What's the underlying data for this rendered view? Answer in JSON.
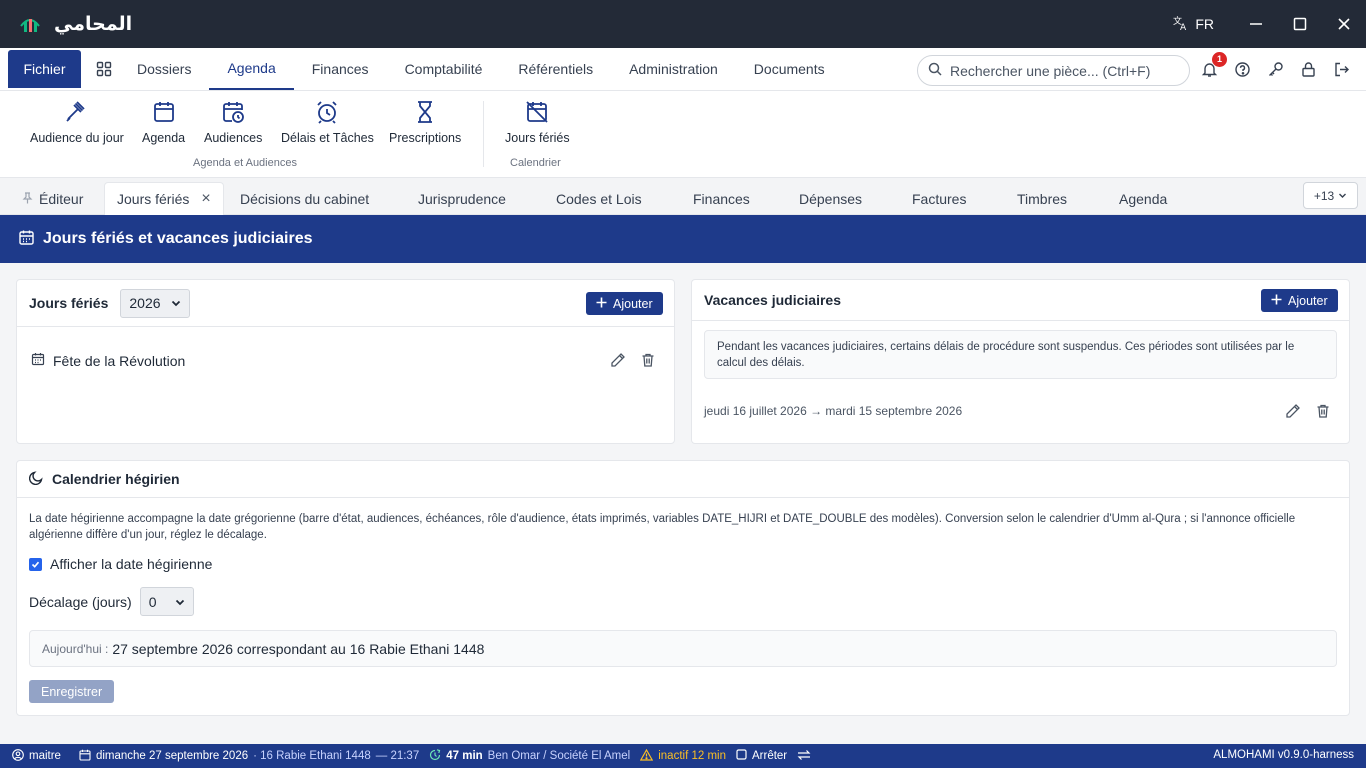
{
  "app": {
    "name": "المحامي",
    "language": "FR"
  },
  "menu": {
    "fichier": "Fichier",
    "items": [
      "Dossiers",
      "Agenda",
      "Finances",
      "Comptabilité",
      "Référentiels",
      "Administration",
      "Documents"
    ],
    "active": "Agenda",
    "search_placeholder": "Rechercher une pièce... (Ctrl+F)",
    "notification_count": "1"
  },
  "ribbon": {
    "buttons": [
      "Audience du jour",
      "Agenda",
      "Audiences",
      "Délais et Tâches",
      "Prescriptions",
      "Jours fériés"
    ],
    "groups": [
      "Agenda et Audiences",
      "Calendrier"
    ]
  },
  "tabs": {
    "items": [
      "Éditeur",
      "Jours fériés",
      "Décisions du cabinet",
      "Jurisprudence",
      "Codes et Lois",
      "Finances",
      "Dépenses",
      "Factures",
      "Timbres",
      "Agenda"
    ],
    "active": "Jours fériés",
    "more": "+13"
  },
  "page": {
    "title": "Jours fériés et vacances judiciaires"
  },
  "holidays": {
    "title": "Jours fériés",
    "year": "2026",
    "add_label": "Ajouter",
    "items": [
      "Fête de la Révolution"
    ]
  },
  "vacations": {
    "title": "Vacances judiciaires",
    "add_label": "Ajouter",
    "info": "Pendant les vacances judiciaires, certains délais de procédure sont suspendus. Ces périodes sont utilisées par le calcul des délais.",
    "period": "jeudi 16 juillet 2026 → mardi 15 septembre 2026"
  },
  "hijri": {
    "title": "Calendrier hégirien",
    "description": "La date hégirienne accompagne la date grégorienne (barre d'état, audiences, échéances, rôle d'audience, états imprimés, variables DATE_HIJRI et DATE_DOUBLE des modèles). Conversion selon le calendrier d'Umm al-Qura ; si l'annonce officielle algérienne diffère d'un jour, réglez le décalage.",
    "show_label": "Afficher la date hégirienne",
    "show_checked": true,
    "offset_label": "Décalage (jours)",
    "offset_value": "0",
    "today_label": "Aujourd'hui :",
    "today_value": "27 septembre 2026 correspondant au 16 Rabie Ethani 1448",
    "save_label": "Enregistrer"
  },
  "statusbar": {
    "user": "maitre",
    "date": "dimanche 27 septembre 2026",
    "hijri": "· 16 Rabie Ethani 1448",
    "time": "— 21:37",
    "timer": "47 min",
    "client": "Ben Omar / Société El Amel",
    "inactive": "inactif 12 min",
    "stop": "Arrêter",
    "version": "ALMOHAMI v0.9.0-harness"
  }
}
